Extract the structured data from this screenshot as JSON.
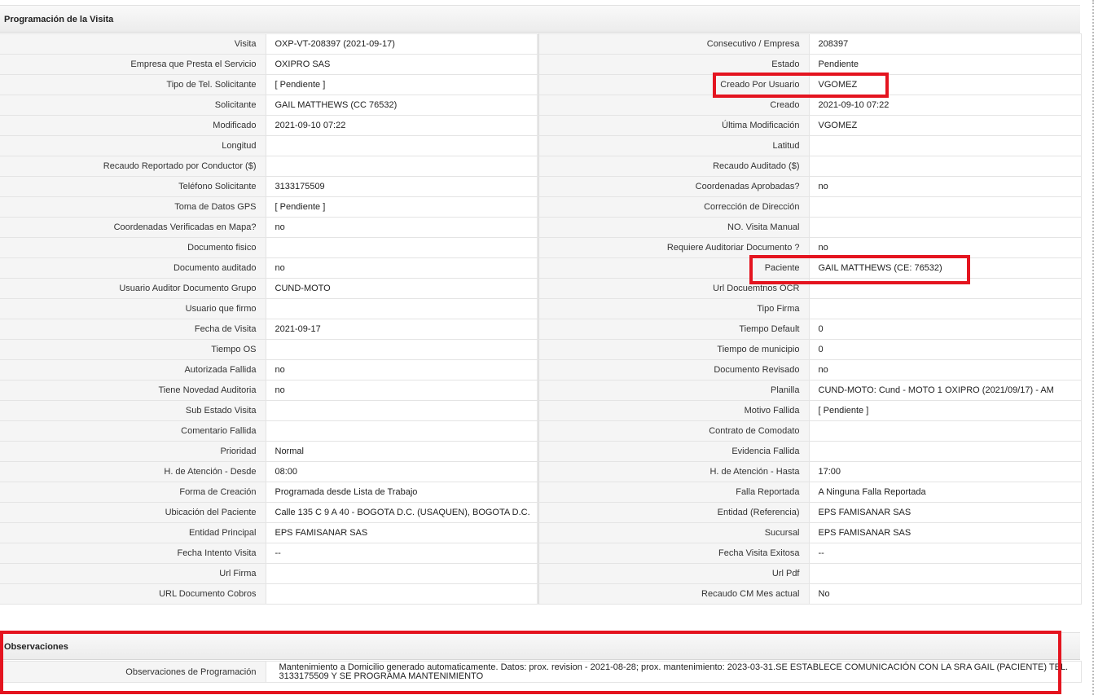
{
  "section_title": "Programación de la Visita",
  "rows": [
    {
      "l1": "Visita",
      "v1": "OXP-VT-208397 (2021-09-17)",
      "l2": "Consecutivo / Empresa",
      "v2": "208397"
    },
    {
      "l1": "Empresa que Presta el Servicio",
      "v1": "OXIPRO SAS",
      "l2": "Estado",
      "v2": "Pendiente"
    },
    {
      "l1": "Tipo de Tel. Solicitante",
      "v1": "[ Pendiente ]",
      "l2": "Creado Por Usuario",
      "v2": "VGOMEZ"
    },
    {
      "l1": "Solicitante",
      "v1": "GAIL MATTHEWS (CC 76532)",
      "l2": "Creado",
      "v2": "2021-09-10 07:22"
    },
    {
      "l1": "Modificado",
      "v1": "2021-09-10 07:22",
      "l2": "Última Modificación",
      "v2": " VGOMEZ"
    },
    {
      "l1": "Longitud",
      "v1": "",
      "l2": "Latitud",
      "v2": ""
    },
    {
      "l1": "Recaudo Reportado por Conductor ($)",
      "v1": "",
      "l2": "Recaudo Auditado ($)",
      "v2": ""
    },
    {
      "l1": "Teléfono Solicitante",
      "v1": "3133175509",
      "l2": "Coordenadas Aprobadas?",
      "v2": " no"
    },
    {
      "l1": "Toma de Datos GPS",
      "v1": "[ Pendiente ]",
      "l2": "Corrección de Dirección",
      "v2": ""
    },
    {
      "l1": "Coordenadas Verificadas en Mapa?",
      "v1": " no",
      "l2": "NO. Visita Manual",
      "v2": ""
    },
    {
      "l1": "Documento fisico",
      "v1": "",
      "l2": "Requiere Auditoriar Documento ?",
      "v2": " no"
    },
    {
      "l1": "Documento auditado",
      "v1": " no",
      "l2": "Paciente",
      "v2": "GAIL MATTHEWS (CE: 76532)"
    },
    {
      "l1": "Usuario Auditor Documento Grupo",
      "v1": "CUND-MOTO",
      "l2": "Url Docuemtnos OCR",
      "v2": ""
    },
    {
      "l1": "Usuario que firmo",
      "v1": "",
      "l2": "Tipo Firma",
      "v2": ""
    },
    {
      "l1": "Fecha de Visita",
      "v1": " 2021-09-17",
      "l2": "Tiempo Default",
      "v2": "0"
    },
    {
      "l1": "Tiempo OS",
      "v1": "",
      "l2": "Tiempo de municipio",
      "v2": "0"
    },
    {
      "l1": "Autorizada Fallida",
      "v1": " no",
      "l2": "Documento Revisado",
      "v2": " no"
    },
    {
      "l1": "Tiene Novedad Auditoria",
      "v1": " no",
      "l2": "Planilla",
      "v2": "CUND-MOTO: Cund - MOTO 1 OXIPRO (2021/09/17) - AM"
    },
    {
      "l1": "Sub Estado Visita",
      "v1": "",
      "l2": "Motivo Fallida",
      "v2": "[ Pendiente ]"
    },
    {
      "l1": "Comentario Fallida",
      "v1": "",
      "l2": "Contrato de Comodato",
      "v2": ""
    },
    {
      "l1": "Prioridad",
      "v1": "Normal",
      "l2": "Evidencia Fallida",
      "v2": ""
    },
    {
      "l1": "H. de Atención - Desde",
      "v1": "08:00",
      "l2": "H. de Atención - Hasta",
      "v2": "17:00"
    },
    {
      "l1": "Forma de Creación",
      "v1": "Programada desde Lista de Trabajo",
      "l2": "Falla Reportada",
      "v2": "A Ninguna Falla Reportada"
    },
    {
      "l1": "Ubicación del Paciente",
      "v1": "Calle 135 C 9 A 40 - BOGOTA D.C. (USAQUEN), BOGOTA D.C.",
      "l2": "Entidad (Referencia)",
      "v2": "EPS FAMISANAR SAS"
    },
    {
      "l1": "Entidad Principal",
      "v1": "EPS FAMISANAR SAS",
      "l2": "Sucursal",
      "v2": "EPS FAMISANAR SAS"
    },
    {
      "l1": "Fecha Intento Visita",
      "v1": " --",
      "l2": "Fecha Visita Exitosa",
      "v2": " --"
    },
    {
      "l1": "Url Firma",
      "v1": "",
      "l2": "Url Pdf",
      "v2": ""
    },
    {
      "l1": "URL Documento Cobros",
      "v1": "",
      "l2": "Recaudo CM Mes actual",
      "v2": "No"
    }
  ],
  "obs": {
    "title": "Observaciones",
    "label": "Observaciones de Programación",
    "value": "Mantenimiento a Domicilio generado automaticamente. Datos: prox. revision - 2021-08-28; prox. mantenimiento: 2023-03-31.SE ESTABLECE COMUNICACIÓN CON LA SRA GAIL (PACIENTE) TEL. 3133175509 Y SE PROGRAMA MANTENIMIENTO"
  },
  "colors": {
    "highlight": "#e4141f",
    "label_bg": "#f5f5f5",
    "header_bg": "#ececec"
  }
}
